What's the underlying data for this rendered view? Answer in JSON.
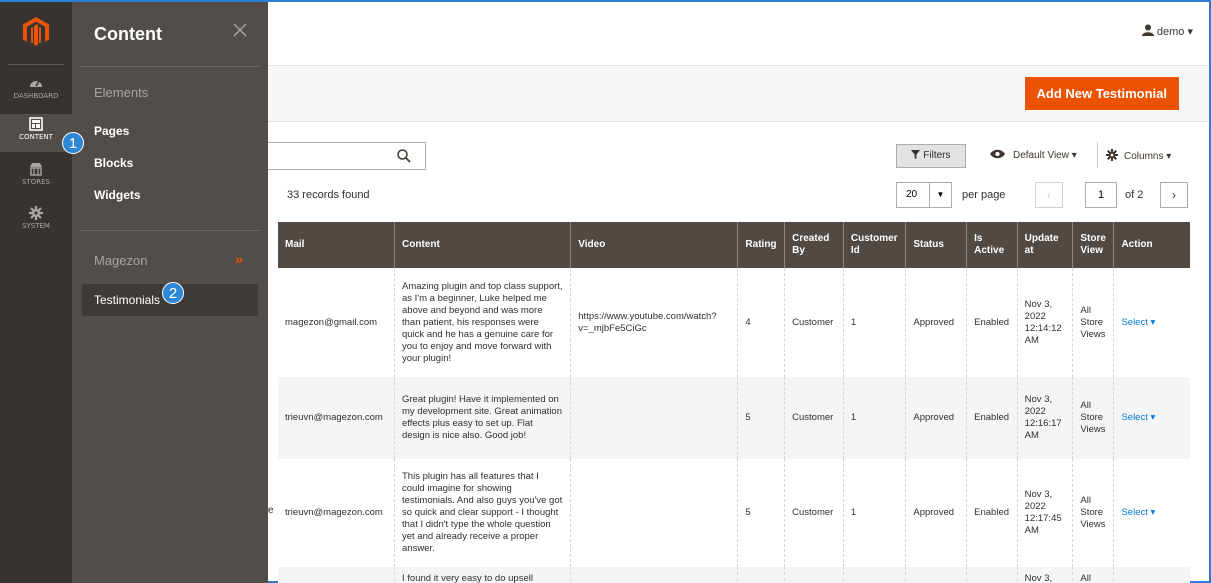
{
  "nav": {
    "items": [
      {
        "label": "DASHBOARD",
        "icon": "dashboard-icon"
      },
      {
        "label": "CONTENT",
        "icon": "content-icon"
      },
      {
        "label": "STORES",
        "icon": "stores-icon"
      },
      {
        "label": "SYSTEM",
        "icon": "system-icon"
      }
    ]
  },
  "flyout": {
    "title": "Content",
    "group1": "Elements",
    "links": [
      "Pages",
      "Blocks",
      "Widgets"
    ],
    "group2": "Magezon",
    "group2_arrow": "»",
    "active_link": "Testimonials",
    "badge1": "1",
    "badge2": "2"
  },
  "header": {
    "user": "demo ▾"
  },
  "actions": {
    "add_button": "Add New Testimonial"
  },
  "toolbar": {
    "filters": "Filters",
    "default_view": "Default View ▾",
    "columns": "Columns ▾",
    "records": "33 records found",
    "per_page_value": "20",
    "per_page_label": "per page",
    "prev": "‹",
    "page": "1",
    "of": "of 2",
    "next": "›"
  },
  "table": {
    "headers": [
      "Mail",
      "Content",
      "Video",
      "Rating",
      "Created By",
      "Customer Id",
      "Status",
      "Is Active",
      "Update at",
      "Store View",
      "Action"
    ],
    "rows": [
      {
        "mail": "magezon@gmail.com",
        "content": "Amazing plugin and top class support, as I'm a beginner, Luke helped me above and beyond and was more than patient, his responses were quick and he has a genuine care for you to enjoy and move forward with your plugin!",
        "video": "https://www.youtube.com/watch?v=_mjbFe5CiGc",
        "rating": "4",
        "created_by": "Customer",
        "customer_id": "1",
        "status": "Approved",
        "is_active": "Enabled",
        "update_at": "Nov 3, 2022 12:14:12 AM",
        "store_view": "All Store Views",
        "action": "Select ▾"
      },
      {
        "mail": "trieuvn@magezon.com",
        "content": "Great plugin! Have it implemented on my development site. Great animation effects plus easy to set up. Flat design is nice also. Good job!",
        "video": "",
        "rating": "5",
        "created_by": "Customer",
        "customer_id": "1",
        "status": "Approved",
        "is_active": "Enabled",
        "update_at": "Nov 3, 2022 12:16:17 AM",
        "store_view": "All Store Views",
        "action": "Select ▾"
      },
      {
        "mail": "trieuvn@magezon.com",
        "content": "This plugin has all features that I could imagine for showing testimonials. And also guys you've got so quick and clear support - I thought that I didn't type the whole question yet and already receive a proper answer.",
        "video": "",
        "rating": "5",
        "created_by": "Customer",
        "customer_id": "1",
        "status": "Approved",
        "is_active": "Enabled",
        "update_at": "Nov 3, 2022 12:17:45 AM",
        "store_view": "All Store Views",
        "action": "Select ▾"
      },
      {
        "mail": "",
        "content": "I found it very easy to do upsell",
        "video": "",
        "rating": "",
        "created_by": "",
        "customer_id": "",
        "status": "",
        "is_active": "",
        "update_at": "Nov 3,",
        "store_view": "All",
        "action": ""
      }
    ],
    "cut_text": "e"
  },
  "colors": {
    "accent": "#eb5202",
    "nav_bg": "#373330",
    "flyout_bg": "#524d49",
    "badge": "#2f88d6",
    "link": "#007bdb"
  }
}
